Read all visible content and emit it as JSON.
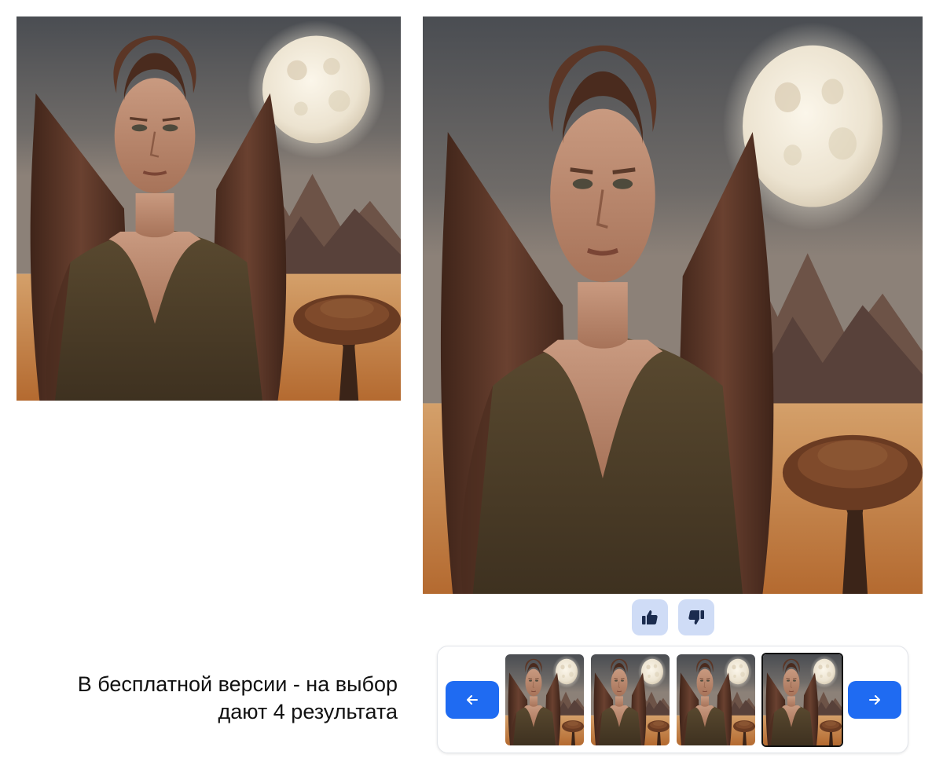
{
  "caption": {
    "line1": "В бесплатной версии - на выбор",
    "line2": "дают 4 результата"
  },
  "images": {
    "preview": {
      "subject": "woman-moon-mountains-tree-portrait"
    },
    "main": {
      "subject": "woman-moon-mountains-tree-portrait"
    }
  },
  "feedback": {
    "like_icon": "thumbs-up-icon",
    "dislike_icon": "thumbs-down-icon"
  },
  "carousel": {
    "prev_icon": "arrow-left-icon",
    "next_icon": "arrow-right-icon",
    "thumbnails": 4,
    "selected_index": 4
  },
  "colors": {
    "accent": "#1f6bf2",
    "feedback_bg": "#cfdcf6",
    "icon_dark": "#1b2c4f"
  }
}
